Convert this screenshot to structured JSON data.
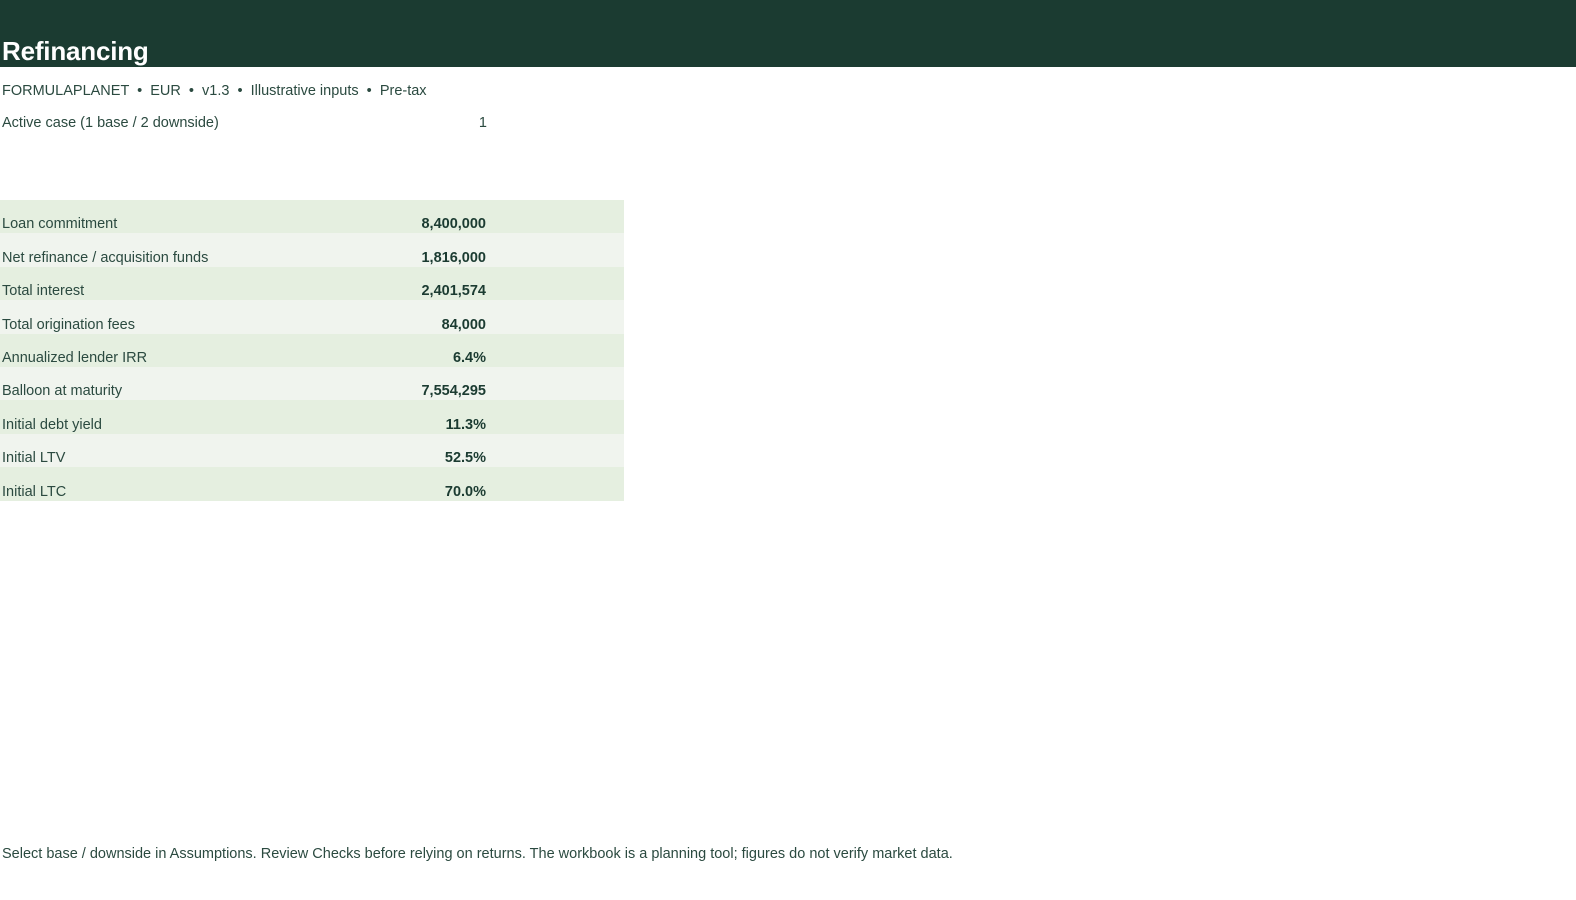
{
  "header": {
    "title": "Refinancing"
  },
  "meta": {
    "line": "FORMULAPLANET  •  EUR  •  v1.3  •  Illustrative inputs  •  Pre-tax"
  },
  "case_selector": {
    "label": "Active case (1 base / 2 downside)",
    "value": "1"
  },
  "summary": {
    "rows": [
      {
        "label": "Loan commitment",
        "value": "8,400,000"
      },
      {
        "label": "Net refinance / acquisition funds",
        "value": "1,816,000"
      },
      {
        "label": "Total interest",
        "value": "2,401,574"
      },
      {
        "label": "Total origination fees",
        "value": "84,000"
      },
      {
        "label": "Annualized lender IRR",
        "value": "6.4%"
      },
      {
        "label": "Balloon at maturity",
        "value": "7,554,295"
      },
      {
        "label": "Initial debt yield",
        "value": "11.3%"
      },
      {
        "label": "Initial LTV",
        "value": "52.5%"
      },
      {
        "label": "Initial LTC",
        "value": "70.0%"
      }
    ]
  },
  "footer": {
    "note": "Select base / downside in Assumptions. Review Checks before relying on returns. The workbook is a planning tool; figures do not verify market data."
  },
  "colors": {
    "header_band": "#1b3b31",
    "row_odd": "#e5efe0",
    "row_even": "#f0f4ee",
    "text": "#2b4a40"
  }
}
